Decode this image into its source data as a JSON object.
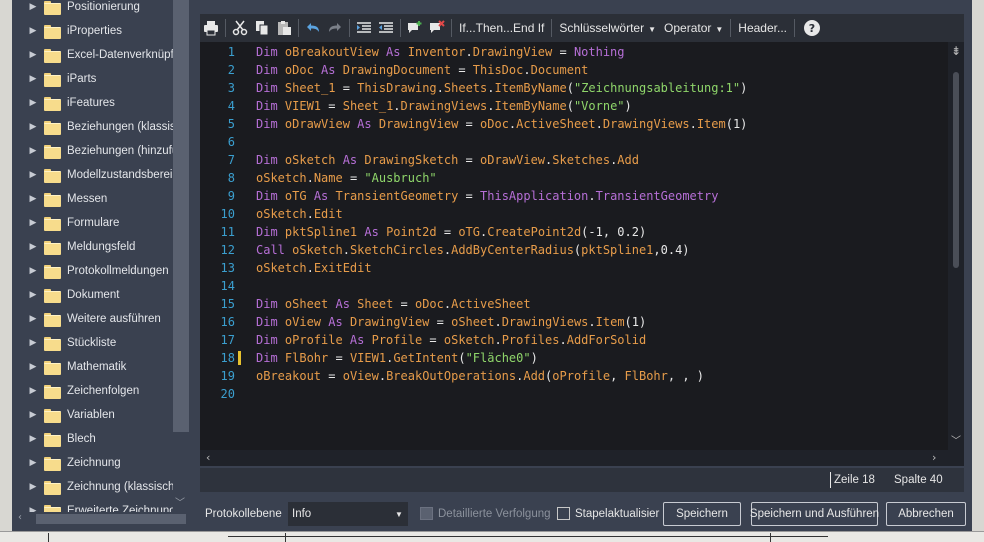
{
  "tree": {
    "items": [
      {
        "label": "Positionierung"
      },
      {
        "label": "iProperties"
      },
      {
        "label": "Excel-Datenverknüpfu"
      },
      {
        "label": "iParts"
      },
      {
        "label": "iFeatures"
      },
      {
        "label": "Beziehungen (klassisch"
      },
      {
        "label": "Beziehungen (hinzufüg"
      },
      {
        "label": "Modellzustandsbereich"
      },
      {
        "label": "Messen"
      },
      {
        "label": "Formulare"
      },
      {
        "label": "Meldungsfeld"
      },
      {
        "label": "Protokollmeldungen"
      },
      {
        "label": "Dokument"
      },
      {
        "label": "Weitere ausführen"
      },
      {
        "label": "Stückliste"
      },
      {
        "label": "Mathematik"
      },
      {
        "label": "Zeichenfolgen"
      },
      {
        "label": "Variablen"
      },
      {
        "label": "Blech"
      },
      {
        "label": "Zeichnung"
      },
      {
        "label": "Zeichnung (klassisch)"
      },
      {
        "label": "Erweiterte Zeichnung"
      }
    ]
  },
  "toolbar": {
    "icons": [
      "print-icon",
      "cut-icon",
      "copy-icon",
      "paste-icon",
      "undo-icon",
      "redo-icon",
      "indent-icon",
      "outdent-icon",
      "add-comment-icon",
      "remove-comment-icon"
    ],
    "if_then": "If...Then...End If",
    "keywords": "Schlüsselwörter",
    "operator": "Operator",
    "header": "Header...",
    "help": "?"
  },
  "code": {
    "lines": [
      {
        "n": "1",
        "tokens": [
          [
            "kw",
            "Dim "
          ],
          [
            "id",
            "oBreakoutView"
          ],
          [
            "kw",
            " As "
          ],
          [
            "id",
            "Inventor"
          ],
          [
            "op",
            "."
          ],
          [
            "id",
            "DrawingView"
          ],
          [
            "op",
            " = "
          ],
          [
            "kw",
            "Nothing"
          ]
        ]
      },
      {
        "n": "2",
        "tokens": [
          [
            "kw",
            "Dim "
          ],
          [
            "id",
            "oDoc"
          ],
          [
            "kw",
            " As "
          ],
          [
            "id",
            "DrawingDocument"
          ],
          [
            "op",
            " = "
          ],
          [
            "id",
            "ThisDoc"
          ],
          [
            "op",
            "."
          ],
          [
            "id",
            "Document"
          ]
        ]
      },
      {
        "n": "3",
        "tokens": [
          [
            "kw",
            "Dim "
          ],
          [
            "id",
            "Sheet_1"
          ],
          [
            "op",
            " = "
          ],
          [
            "id",
            "ThisDrawing"
          ],
          [
            "op",
            "."
          ],
          [
            "id",
            "Sheets"
          ],
          [
            "op",
            "."
          ],
          [
            "id",
            "ItemByName"
          ],
          [
            "op",
            "("
          ],
          [
            "str",
            "\"Zeichnungsableitung:1\""
          ],
          [
            "op",
            ")"
          ]
        ]
      },
      {
        "n": "4",
        "tokens": [
          [
            "kw",
            "Dim "
          ],
          [
            "id",
            "VIEW1"
          ],
          [
            "op",
            " = "
          ],
          [
            "id",
            "Sheet_1"
          ],
          [
            "op",
            "."
          ],
          [
            "id",
            "DrawingViews"
          ],
          [
            "op",
            "."
          ],
          [
            "id",
            "ItemByName"
          ],
          [
            "op",
            "("
          ],
          [
            "str",
            "\"Vorne\""
          ],
          [
            "op",
            ")"
          ]
        ]
      },
      {
        "n": "5",
        "tokens": [
          [
            "kw",
            "Dim "
          ],
          [
            "id",
            "oDrawView"
          ],
          [
            "kw",
            " As "
          ],
          [
            "id",
            "DrawingView"
          ],
          [
            "op",
            " = "
          ],
          [
            "id",
            "oDoc"
          ],
          [
            "op",
            "."
          ],
          [
            "id",
            "ActiveSheet"
          ],
          [
            "op",
            "."
          ],
          [
            "id",
            "DrawingViews"
          ],
          [
            "op",
            "."
          ],
          [
            "id",
            "Item"
          ],
          [
            "op",
            "(1)"
          ]
        ]
      },
      {
        "n": "6",
        "tokens": []
      },
      {
        "n": "7",
        "tokens": [
          [
            "kw",
            "Dim "
          ],
          [
            "id",
            "oSketch"
          ],
          [
            "kw",
            " As "
          ],
          [
            "id",
            "DrawingSketch"
          ],
          [
            "op",
            " = "
          ],
          [
            "id",
            "oDrawView"
          ],
          [
            "op",
            "."
          ],
          [
            "id",
            "Sketches"
          ],
          [
            "op",
            "."
          ],
          [
            "id",
            "Add"
          ]
        ]
      },
      {
        "n": "8",
        "tokens": [
          [
            "id",
            "oSketch"
          ],
          [
            "op",
            "."
          ],
          [
            "id",
            "Name"
          ],
          [
            "op",
            " = "
          ],
          [
            "str",
            "\"Ausbruch\""
          ]
        ]
      },
      {
        "n": "9",
        "tokens": [
          [
            "kw",
            "Dim "
          ],
          [
            "id",
            "oTG"
          ],
          [
            "kw",
            " As "
          ],
          [
            "id",
            "TransientGeometry"
          ],
          [
            "op",
            " = "
          ],
          [
            "typ",
            "ThisApplication"
          ],
          [
            "op",
            "."
          ],
          [
            "typ",
            "TransientGeometry"
          ]
        ]
      },
      {
        "n": "10",
        "tokens": [
          [
            "id",
            "oSketch"
          ],
          [
            "op",
            "."
          ],
          [
            "id",
            "Edit"
          ]
        ]
      },
      {
        "n": "11",
        "tokens": [
          [
            "kw",
            "Dim "
          ],
          [
            "id",
            "pktSpline1"
          ],
          [
            "kw",
            " As "
          ],
          [
            "id",
            "Point2d"
          ],
          [
            "op",
            " = "
          ],
          [
            "id",
            "oTG"
          ],
          [
            "op",
            "."
          ],
          [
            "id",
            "CreatePoint2d"
          ],
          [
            "op",
            "(-1, 0.2)"
          ]
        ]
      },
      {
        "n": "12",
        "tokens": [
          [
            "kw",
            "Call "
          ],
          [
            "id",
            "oSketch"
          ],
          [
            "op",
            "."
          ],
          [
            "id",
            "SketchCircles"
          ],
          [
            "op",
            "."
          ],
          [
            "id",
            "AddByCenterRadius"
          ],
          [
            "op",
            "("
          ],
          [
            "id",
            "pktSpline1"
          ],
          [
            "op",
            ",0.4)"
          ]
        ]
      },
      {
        "n": "13",
        "tokens": [
          [
            "id",
            "oSketch"
          ],
          [
            "op",
            "."
          ],
          [
            "id",
            "ExitEdit"
          ]
        ]
      },
      {
        "n": "14",
        "tokens": []
      },
      {
        "n": "15",
        "tokens": [
          [
            "kw",
            "Dim "
          ],
          [
            "id",
            "oSheet"
          ],
          [
            "kw",
            " As "
          ],
          [
            "id",
            "Sheet"
          ],
          [
            "op",
            " = "
          ],
          [
            "id",
            "oDoc"
          ],
          [
            "op",
            "."
          ],
          [
            "id",
            "ActiveSheet"
          ]
        ]
      },
      {
        "n": "16",
        "tokens": [
          [
            "kw",
            "Dim "
          ],
          [
            "id",
            "oView"
          ],
          [
            "kw",
            " As "
          ],
          [
            "id",
            "DrawingView"
          ],
          [
            "op",
            " = "
          ],
          [
            "id",
            "oSheet"
          ],
          [
            "op",
            "."
          ],
          [
            "id",
            "DrawingViews"
          ],
          [
            "op",
            "."
          ],
          [
            "id",
            "Item"
          ],
          [
            "op",
            "(1)"
          ]
        ]
      },
      {
        "n": "17",
        "tokens": [
          [
            "kw",
            "Dim "
          ],
          [
            "id",
            "oProfile"
          ],
          [
            "kw",
            " As "
          ],
          [
            "id",
            "Profile"
          ],
          [
            "op",
            " = "
          ],
          [
            "id",
            "oSketch"
          ],
          [
            "op",
            "."
          ],
          [
            "id",
            "Profiles"
          ],
          [
            "op",
            "."
          ],
          [
            "id",
            "AddForSolid"
          ]
        ]
      },
      {
        "n": "18",
        "tokens": [
          [
            "kw",
            "Dim "
          ],
          [
            "id",
            "FlBohr"
          ],
          [
            "op",
            " = "
          ],
          [
            "id",
            "VIEW1"
          ],
          [
            "op",
            "."
          ],
          [
            "id",
            "GetIntent"
          ],
          [
            "op",
            "("
          ],
          [
            "str",
            "\"Fläche0\""
          ],
          [
            "op",
            ")"
          ]
        ],
        "changed": true
      },
      {
        "n": "19",
        "tokens": [
          [
            "id",
            "oBreakout"
          ],
          [
            "op",
            " = "
          ],
          [
            "id",
            "oView"
          ],
          [
            "op",
            "."
          ],
          [
            "id",
            "BreakOutOperations"
          ],
          [
            "op",
            "."
          ],
          [
            "id",
            "Add"
          ],
          [
            "op",
            "("
          ],
          [
            "id",
            "oProfile"
          ],
          [
            "op",
            ", "
          ],
          [
            "id",
            "FlBohr"
          ],
          [
            "op",
            ", , )"
          ]
        ]
      },
      {
        "n": "20",
        "tokens": []
      }
    ]
  },
  "status": {
    "line": "Zeile 18",
    "column": "Spalte 40"
  },
  "bottom": {
    "log_level_label": "Protokollebene",
    "log_level_value": "Info",
    "detailed_trace": "Detaillierte Verfolgung",
    "stack_update": "Stapelaktualisier",
    "save": "Speichern",
    "save_run": "Speichern und Ausführen",
    "cancel": "Abbrechen"
  },
  "colors": {
    "keyword": "#b66fd6",
    "identifier": "#e79c4a",
    "string": "#8fd66a",
    "line_number": "#3b9fcf",
    "change_marker": "#e7c12f"
  }
}
